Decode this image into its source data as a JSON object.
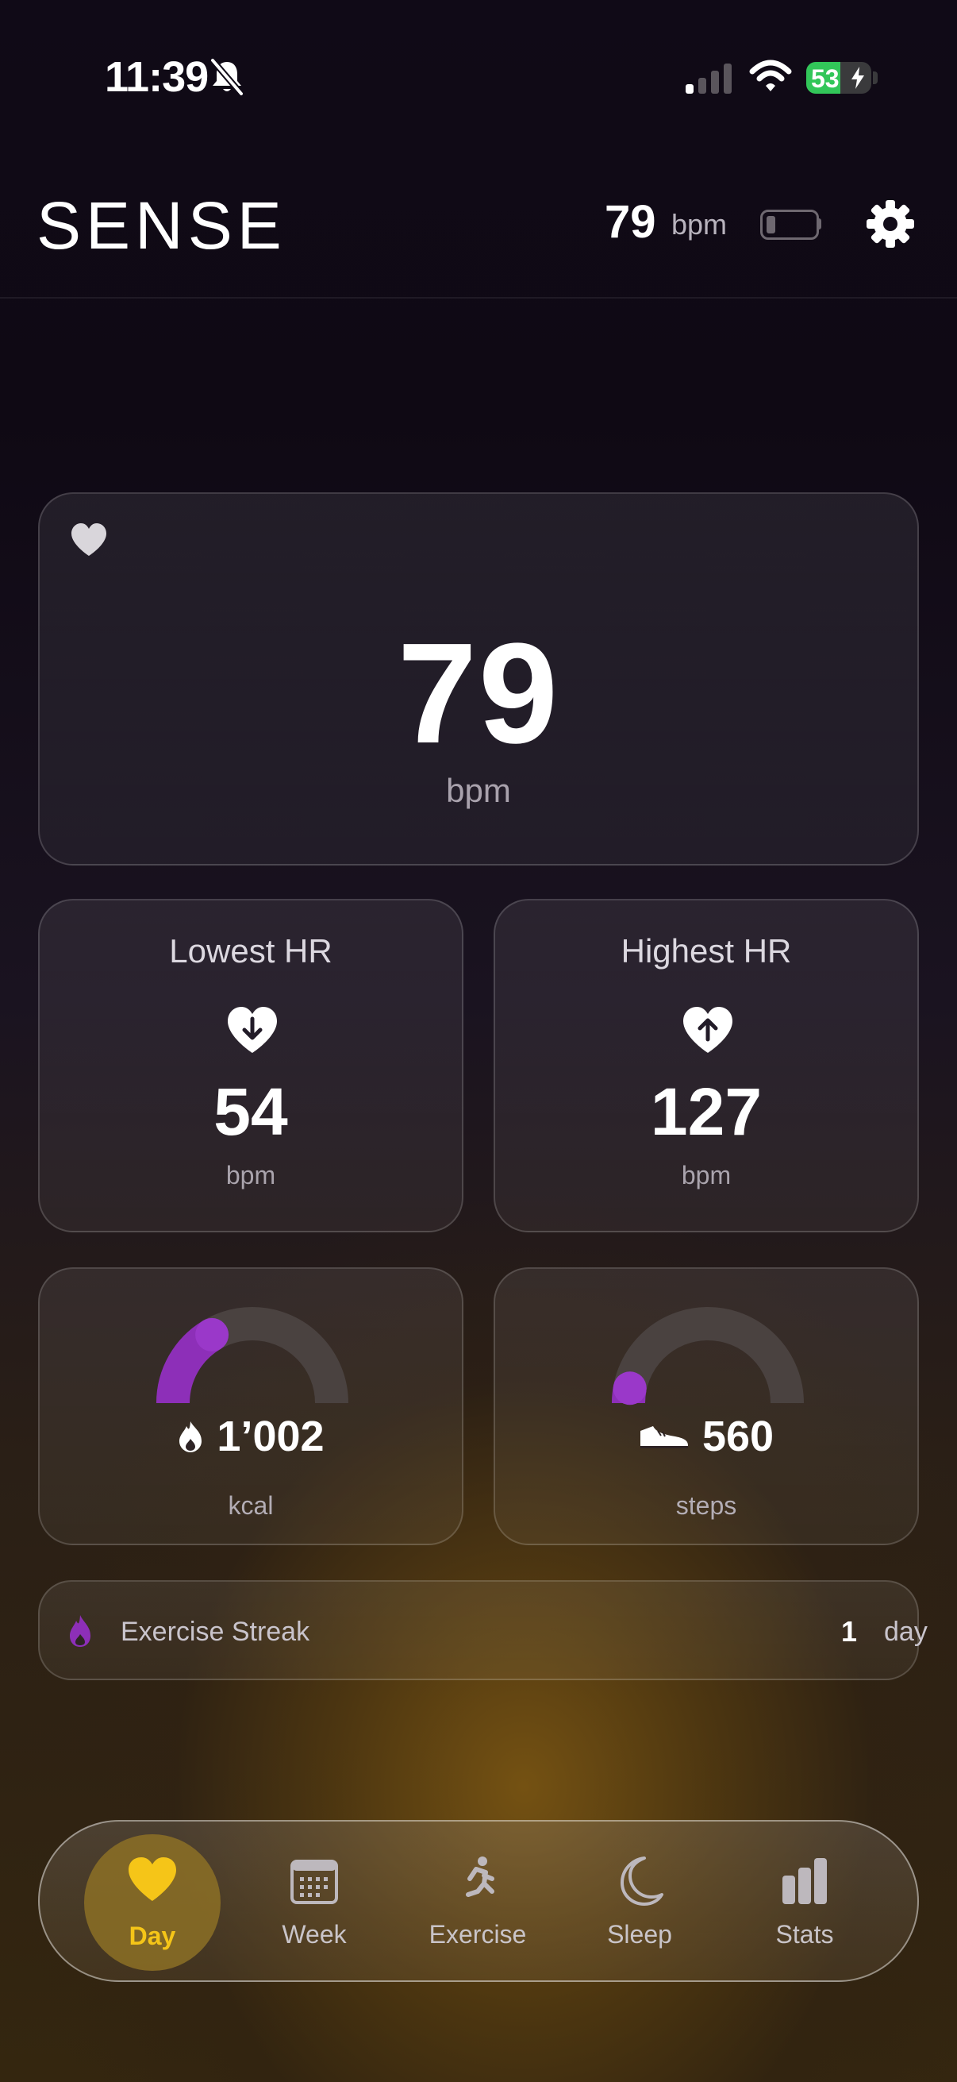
{
  "status_bar": {
    "time": "11:39",
    "battery_percent": "53",
    "battery_level": 0.53,
    "colors": {
      "battery": "#32c659"
    }
  },
  "header": {
    "app_title": "SENSE",
    "heart_rate": "79",
    "heart_rate_unit": "bpm",
    "device_battery_level": 0.2,
    "icons": {
      "device_battery": "battery-low-icon",
      "settings": "gear-icon"
    }
  },
  "current_hr": {
    "value": "79",
    "unit": "bpm",
    "icon": "heart-icon"
  },
  "lowest_hr": {
    "title": "Lowest HR",
    "value": "54",
    "unit": "bpm",
    "icon": "heart-arrow-down-icon"
  },
  "highest_hr": {
    "title": "Highest HR",
    "value": "127",
    "unit": "bpm",
    "icon": "heart-arrow-up-icon"
  },
  "calories": {
    "value": "1’002",
    "unit": "kcal",
    "progress": 0.33,
    "icon": "flame-icon"
  },
  "steps": {
    "value": "560",
    "unit": "steps",
    "progress": 0.06,
    "icon": "shoe-icon"
  },
  "streak": {
    "label": "Exercise Streak",
    "count": "1",
    "unit": "day",
    "icon": "flame-icon"
  },
  "tabs": [
    {
      "label": "Day",
      "icon": "heart-icon",
      "active": true
    },
    {
      "label": "Week",
      "icon": "calendar-icon",
      "active": false
    },
    {
      "label": "Exercise",
      "icon": "running-figure-icon",
      "active": false
    },
    {
      "label": "Sleep",
      "icon": "moon-icon",
      "active": false
    },
    {
      "label": "Stats",
      "icon": "bar-chart-icon",
      "active": false
    }
  ],
  "colors": {
    "accent_purple": "#8d2fb8",
    "active_tab": "#f5c518",
    "gauge_track": "#4a4240"
  }
}
